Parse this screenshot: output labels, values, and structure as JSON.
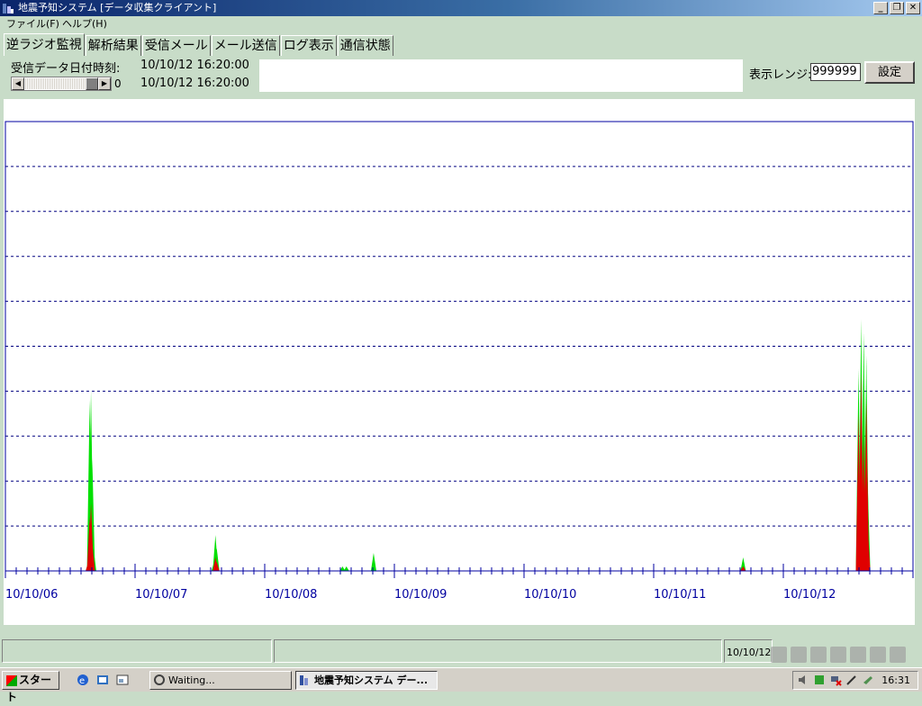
{
  "window": {
    "title": "地震予知システム [データ収集クライアント]"
  },
  "menu": {
    "items": [
      "ファイル(F)",
      "ヘルプ(H)"
    ]
  },
  "tabs": [
    "逆ラジオ監視",
    "解析結果",
    "受信メール",
    "メール送信",
    "ログ表示",
    "通信状態"
  ],
  "header": {
    "recv_label": "受信データ日付時刻:",
    "recv_time1": "10/10/12 16:20:00",
    "recv_time2": "10/10/12 16:20:00",
    "scroll_value": "0",
    "range_label": "表示レンジ:",
    "range_value": "999999",
    "set_button": "設定"
  },
  "chart_data": {
    "type": "area",
    "x_labels": [
      "10/10/06",
      "10/10/07",
      "10/10/08",
      "10/10/09",
      "10/10/10",
      "10/10/11",
      "10/10/12"
    ],
    "xlim": [
      "10/10/06 00:00",
      "10/10/13 00:00"
    ],
    "ylim": [
      0,
      10
    ],
    "grid": true,
    "colors": {
      "total": "#00e000",
      "sub": "#e00000",
      "axis": "#0000a0",
      "grid": "#000080"
    },
    "series": [
      {
        "values": [
          [
            0.64,
            0.2
          ],
          [
            0.65,
            3.8
          ],
          [
            0.66,
            4.0
          ],
          [
            0.67,
            2.5
          ],
          [
            0.68,
            0.5
          ],
          [
            1.61,
            0.2
          ],
          [
            1.62,
            0.8
          ],
          [
            1.63,
            0.5
          ],
          [
            2.6,
            0.1
          ],
          [
            2.63,
            0.1
          ],
          [
            2.84,
            0.4
          ],
          [
            5.69,
            0.3
          ],
          [
            6.58,
            4.5
          ],
          [
            6.6,
            5.6
          ],
          [
            6.62,
            5.3
          ],
          [
            6.64,
            4.8
          ],
          [
            6.65,
            2.0
          ]
        ]
      },
      {
        "values": [
          [
            0.64,
            0.2
          ],
          [
            0.65,
            1.2
          ],
          [
            0.66,
            1.5
          ],
          [
            0.67,
            0.6
          ],
          [
            1.62,
            0.3
          ],
          [
            1.63,
            0.2
          ],
          [
            5.69,
            0.1
          ],
          [
            6.58,
            3.5
          ],
          [
            6.6,
            4.4
          ],
          [
            6.62,
            3.0
          ],
          [
            6.64,
            3.8
          ],
          [
            6.65,
            1.0
          ]
        ]
      }
    ]
  },
  "status": {
    "panel3": "10/10/12"
  },
  "taskbar": {
    "start": "スタート",
    "tasks": [
      {
        "label": "Waiting..."
      },
      {
        "label": "地震予知システム デー..."
      }
    ],
    "clock": "16:31"
  }
}
